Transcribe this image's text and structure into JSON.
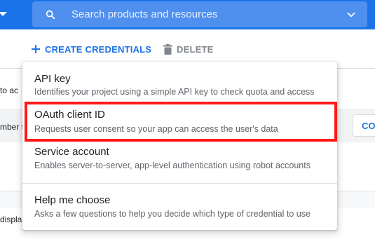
{
  "topbar": {
    "search_placeholder": "Search products and resources"
  },
  "toolbar": {
    "create_label": "CREATE CREDENTIALS",
    "delete_label": "DELETE"
  },
  "background": {
    "line1": "to ac",
    "line2": "mber t",
    "line3": "displa",
    "button_partial": "CO"
  },
  "menu": {
    "items": [
      {
        "title": "API key",
        "description": "Identifies your project using a simple API key to check quota and access"
      },
      {
        "title": "OAuth client ID",
        "description": "Requests user consent so your app can access the user's data"
      },
      {
        "title": "Service account",
        "description": "Enables server-to-server, app-level authentication using robot accounts"
      },
      {
        "title": "Help me choose",
        "description": "Asks a few questions to help you decide which type of credential to use"
      }
    ]
  },
  "colors": {
    "topbar": "#1a73e8",
    "accent": "#1a73e8",
    "highlight": "#ff1a1a"
  }
}
